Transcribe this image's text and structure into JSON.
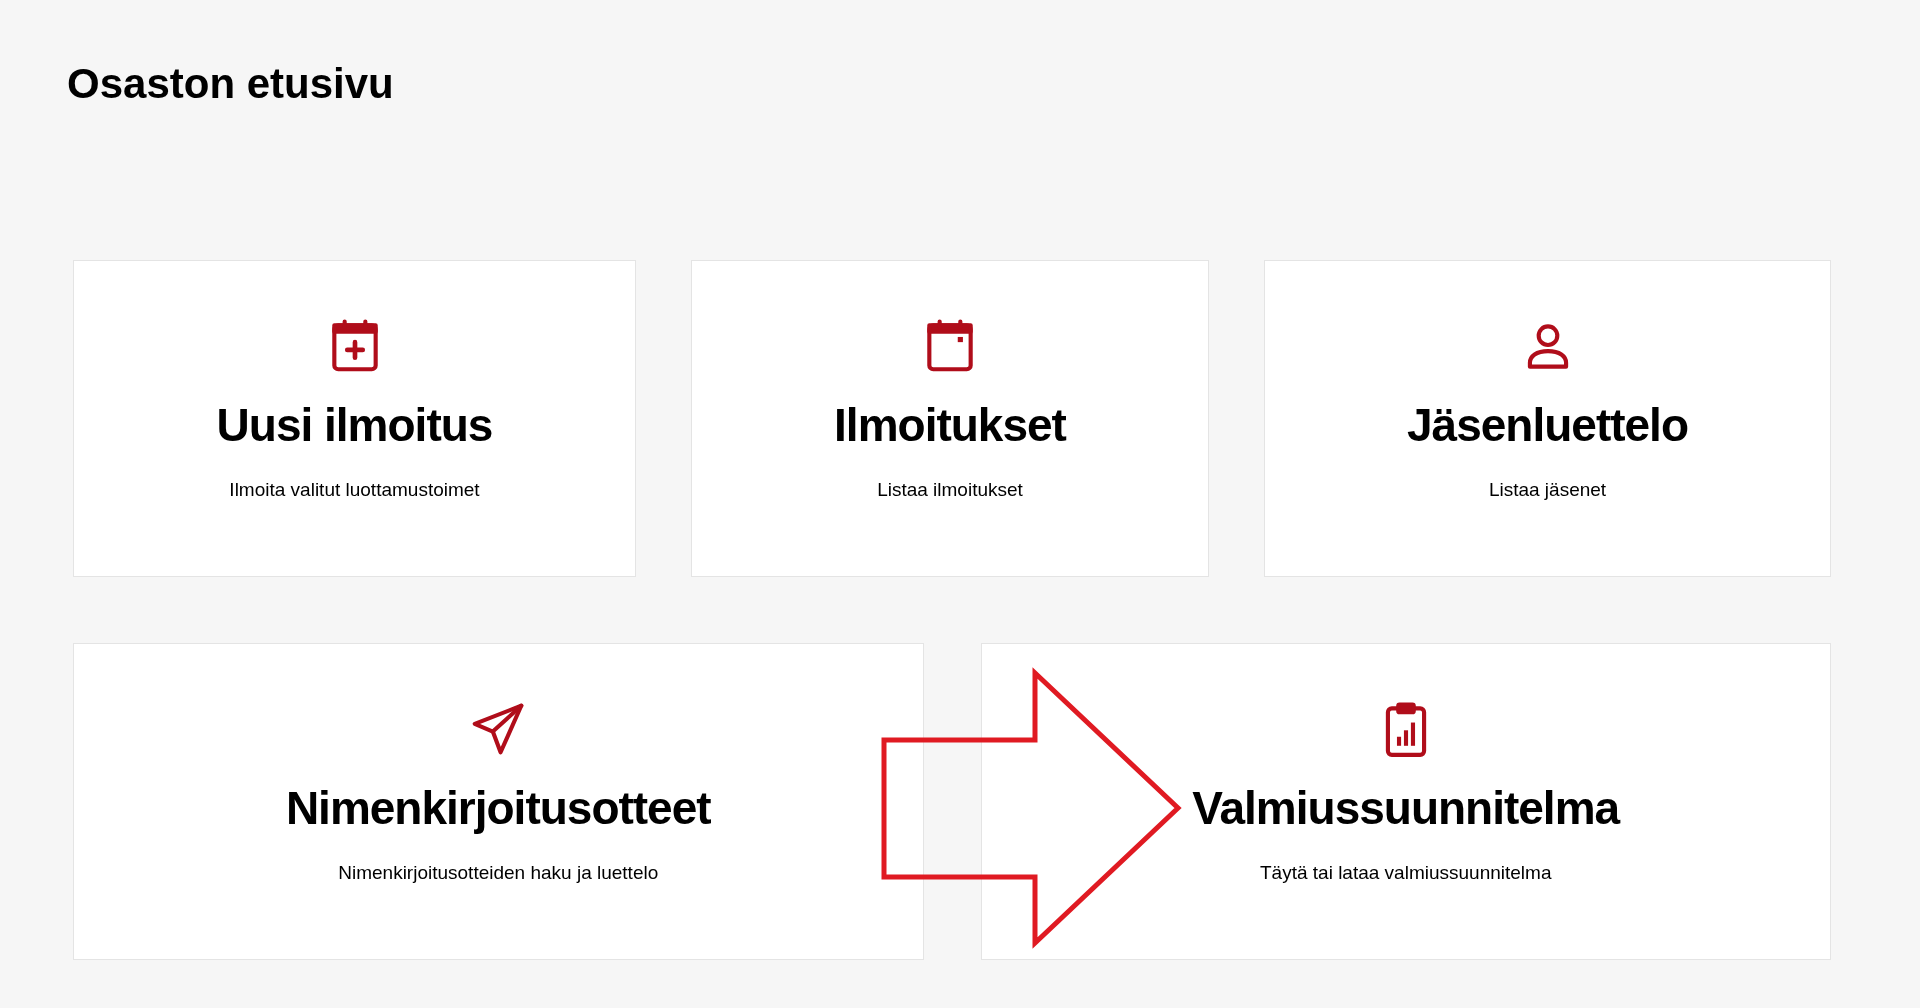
{
  "page": {
    "title": "Osaston etusivu"
  },
  "rows": [
    {
      "cards": [
        {
          "kind": "calendar-plus",
          "title": "Uusi ilmoitus",
          "subtitle": "Ilmoita valitut luottamustoimet"
        },
        {
          "kind": "calendar",
          "title": "Ilmoitukset",
          "subtitle": "Listaa ilmoitukset"
        },
        {
          "kind": "user",
          "title": "Jäsenluettelo",
          "subtitle": "Listaa jäsenet"
        }
      ]
    },
    {
      "cards": [
        {
          "kind": "send",
          "title": "Nimenkirjoitusotteet",
          "subtitle": "Nimenkirjoitusotteiden haku ja luettelo"
        },
        {
          "kind": "clipboard-chart",
          "title": "Valmiussuunnitelma",
          "subtitle": "Täytä tai lataa valmiussuunnitelma"
        }
      ]
    }
  ],
  "annotation": {
    "kind": "arrow"
  }
}
